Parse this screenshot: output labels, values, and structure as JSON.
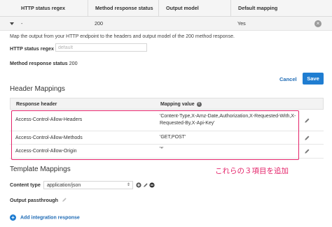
{
  "top_table": {
    "headers": [
      "HTTP status regex",
      "Method response status",
      "Output model",
      "Default mapping"
    ],
    "row": {
      "regex": "-",
      "status": "200",
      "model": "",
      "default_mapping": "Yes"
    }
  },
  "detail": {
    "description": "Map the output from your HTTP endpoint to the headers and output model of the 200 method response.",
    "regex_label": "HTTP status regex",
    "regex_placeholder": "default",
    "status_label": "Method response status",
    "status_value": "200",
    "cancel_label": "Cancel",
    "save_label": "Save"
  },
  "header_mappings": {
    "title": "Header Mappings",
    "col_response_header": "Response header",
    "col_mapping_value": "Mapping value",
    "rows": [
      {
        "header": "Access-Control-Allow-Headers",
        "value": "'Content-Type,X-Amz-Date,Authorization,X-Requested-With,X-Requested-By,X-Api-Key'"
      },
      {
        "header": "Access-Control-Allow-Methods",
        "value": "'GET,POST'"
      },
      {
        "header": "Access-Control-Allow-Origin",
        "value": "'*'"
      }
    ]
  },
  "annotation": "これらの３項目を追加",
  "template_mappings": {
    "title": "Template Mappings",
    "content_type_label": "Content type",
    "content_type_value": "application/json",
    "output_passthrough_label": "Output passthrough"
  },
  "add_integration_label": "Add integration response",
  "colors": {
    "accent_blue": "#1f7dd1",
    "highlight_pink": "#e4246a"
  }
}
